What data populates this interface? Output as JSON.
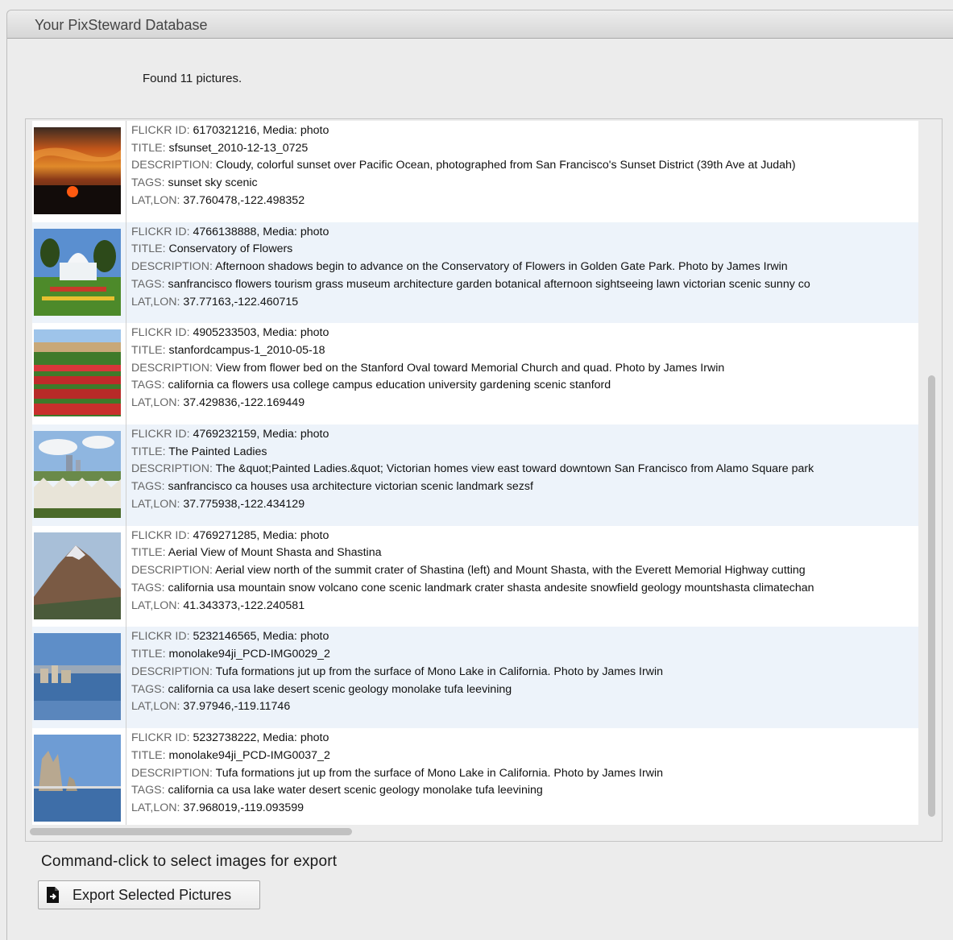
{
  "window": {
    "title": "Your PixSteward Database"
  },
  "status": {
    "found_text": "Found 11 pictures."
  },
  "labels": {
    "flickr_id": "FLICKR ID:",
    "media": "Media:",
    "title": "TITLE:",
    "description": "DESCRIPTION:",
    "tags": "TAGS:",
    "latlon": "LAT,LON:"
  },
  "pictures": [
    {
      "flickr_id": "6170321216",
      "media": "photo",
      "title": "sfsunset_2010-12-13_0725",
      "description": "Cloudy, colorful sunset over Pacific Ocean, photographed from San Francisco's Sunset District (39th Ave at Judah)",
      "tags": "sunset sky scenic",
      "latlon": "37.760478,-122.498352"
    },
    {
      "flickr_id": "4766138888",
      "media": "photo",
      "title": "Conservatory of Flowers",
      "description": "Afternoon shadows begin to advance on the Conservatory of Flowers in Golden Gate Park. Photo by James Irwin",
      "tags": "sanfrancisco flowers tourism grass museum architecture garden botanical afternoon sightseeing lawn victorian scenic sunny co",
      "latlon": "37.77163,-122.460715"
    },
    {
      "flickr_id": "4905233503",
      "media": "photo",
      "title": "stanfordcampus-1_2010-05-18",
      "description": "View from flower bed on the Stanford Oval toward Memorial Church and quad. Photo by James Irwin",
      "tags": "california ca flowers usa college campus education university gardening scenic stanford",
      "latlon": "37.429836,-122.169449"
    },
    {
      "flickr_id": "4769232159",
      "media": "photo",
      "title": "The Painted Ladies",
      "description": " The &quot;Painted Ladies.&quot; Victorian homes view east toward downtown San Francisco from Alamo Square park",
      "tags": "sanfrancisco ca houses usa architecture victorian scenic landmark sezsf",
      "latlon": "37.775938,-122.434129"
    },
    {
      "flickr_id": "4769271285",
      "media": "photo",
      "title": "Aerial View of Mount Shasta and Shastina",
      "description": "Aerial view north of the summit crater of Shastina (left) and Mount Shasta, with the Everett Memorial Highway cutting",
      "tags": "california usa mountain snow volcano cone scenic landmark crater shasta andesite snowfield geology mountshasta climatechan",
      "latlon": "41.343373,-122.240581"
    },
    {
      "flickr_id": "5232146565",
      "media": "photo",
      "title": "monolake94ji_PCD-IMG0029_2",
      "description": "Tufa formations jut up from the surface of Mono Lake in California. Photo by James Irwin",
      "tags": "california ca usa lake desert scenic geology monolake tufa leevining",
      "latlon": "37.97946,-119.11746"
    },
    {
      "flickr_id": "5232738222",
      "media": "photo",
      "title": "monolake94ji_PCD-IMG0037_2",
      "description": "Tufa formations jut up from the surface of Mono Lake in California. Photo by James Irwin",
      "tags": "california ca usa lake water desert scenic geology monolake tufa leevining",
      "latlon": "37.968019,-119.093599"
    }
  ],
  "footer": {
    "hint": "Command-click to select images for export",
    "export_button_label": "Export Selected Pictures",
    "export_icon": "export-document-icon"
  }
}
